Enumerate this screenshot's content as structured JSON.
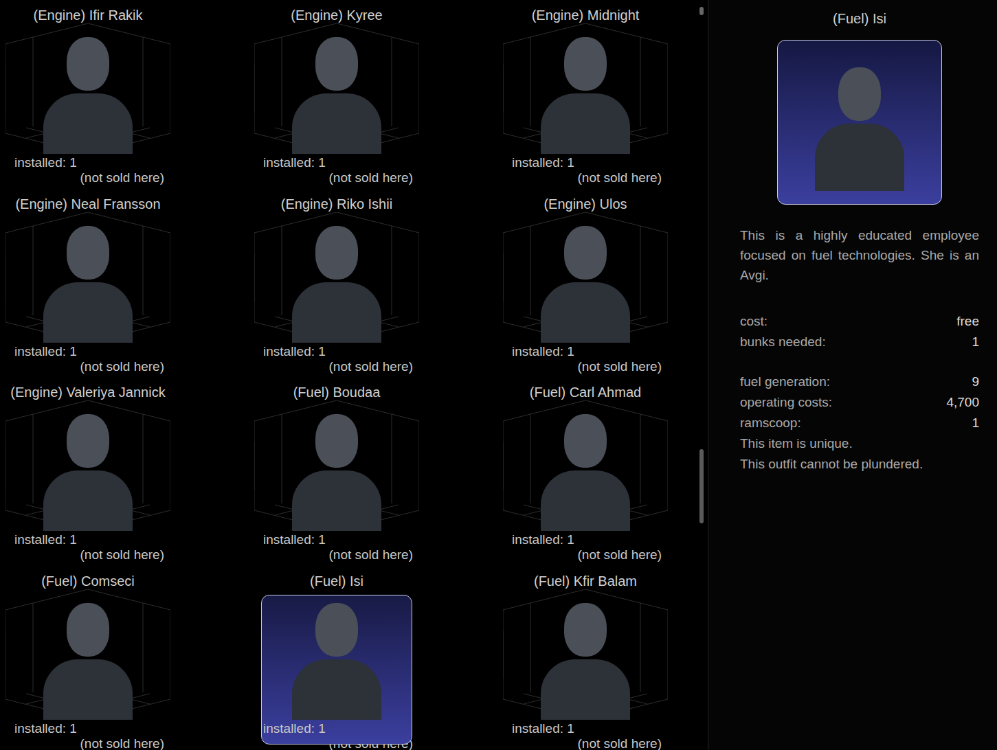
{
  "outfits": [
    {
      "title": "(Engine) Ifir Rakik",
      "installed": "installed: 1",
      "availability": "(not sold here)",
      "selected": false
    },
    {
      "title": "(Engine) Kyree",
      "installed": "installed: 1",
      "availability": "(not sold here)",
      "selected": false
    },
    {
      "title": "(Engine) Midnight",
      "installed": "installed: 1",
      "availability": "(not sold here)",
      "selected": false
    },
    {
      "title": "(Engine) Neal Fransson",
      "installed": "installed: 1",
      "availability": "(not sold here)",
      "selected": false
    },
    {
      "title": "(Engine) Riko Ishii",
      "installed": "installed: 1",
      "availability": "(not sold here)",
      "selected": false
    },
    {
      "title": "(Engine) Ulos",
      "installed": "installed: 1",
      "availability": "(not sold here)",
      "selected": false
    },
    {
      "title": "(Engine) Valeriya Jannick",
      "installed": "installed: 1",
      "availability": "(not sold here)",
      "selected": false
    },
    {
      "title": "(Fuel) Boudaa",
      "installed": "installed: 1",
      "availability": "(not sold here)",
      "selected": false
    },
    {
      "title": "(Fuel) Carl Ahmad",
      "installed": "installed: 1",
      "availability": "(not sold here)",
      "selected": false
    },
    {
      "title": "(Fuel) Comseci",
      "installed": "installed: 1",
      "availability": "(not sold here)",
      "selected": false
    },
    {
      "title": "(Fuel) Isi",
      "installed": "installed: 1",
      "availability": "(not sold here)",
      "selected": true
    },
    {
      "title": "(Fuel) Kfir Balam",
      "installed": "installed: 1",
      "availability": "(not sold here)",
      "selected": false
    }
  ],
  "scrollbar": {
    "level": 0.1,
    "offset": 0.6
  },
  "detail": {
    "title": "(Fuel) Isi",
    "description": "This is a highly educated employee focused on fuel technologies. She is an Avgi.",
    "stats": [
      {
        "label": "cost:",
        "value": "free"
      },
      {
        "label": "bunks needed:",
        "value": "1"
      }
    ],
    "attributes": [
      {
        "label": "fuel generation:",
        "value": "9"
      },
      {
        "label": "operating costs:",
        "value": "4,700"
      },
      {
        "label": "ramscoop:",
        "value": "1"
      }
    ],
    "notes": [
      "This item is unique.",
      "This outfit cannot be plundered."
    ]
  }
}
